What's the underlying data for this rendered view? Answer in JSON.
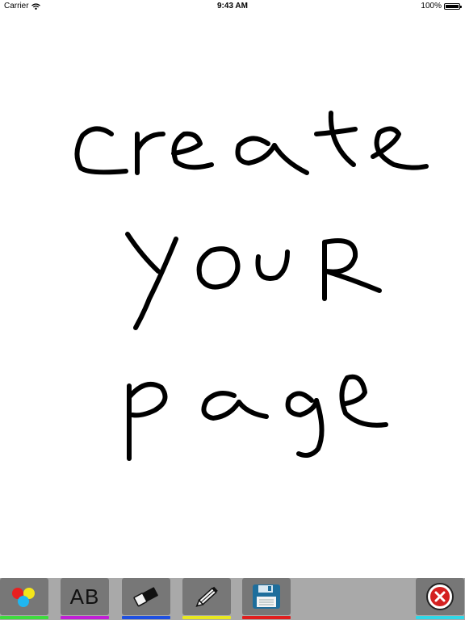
{
  "status": {
    "carrier": "Carrier",
    "time": "9:43 AM",
    "battery": "100%"
  },
  "canvas": {
    "drawing_text": "create your page",
    "ink_color": "#000000"
  },
  "toolbar": {
    "tools": [
      {
        "name": "colors",
        "icon": "color-palette-icon",
        "underline": "#3ddc3d"
      },
      {
        "name": "text",
        "label": "AB",
        "icon": "text-icon",
        "underline": "#c21fd6"
      },
      {
        "name": "eraser",
        "icon": "eraser-icon",
        "underline": "#1f50e0"
      },
      {
        "name": "pencil",
        "icon": "pencil-icon",
        "underline": "#e8e820"
      },
      {
        "name": "save",
        "icon": "floppy-disk-icon",
        "underline": "#e01e1e"
      },
      {
        "name": "close",
        "icon": "close-icon",
        "underline": "#30d8e8"
      }
    ]
  }
}
